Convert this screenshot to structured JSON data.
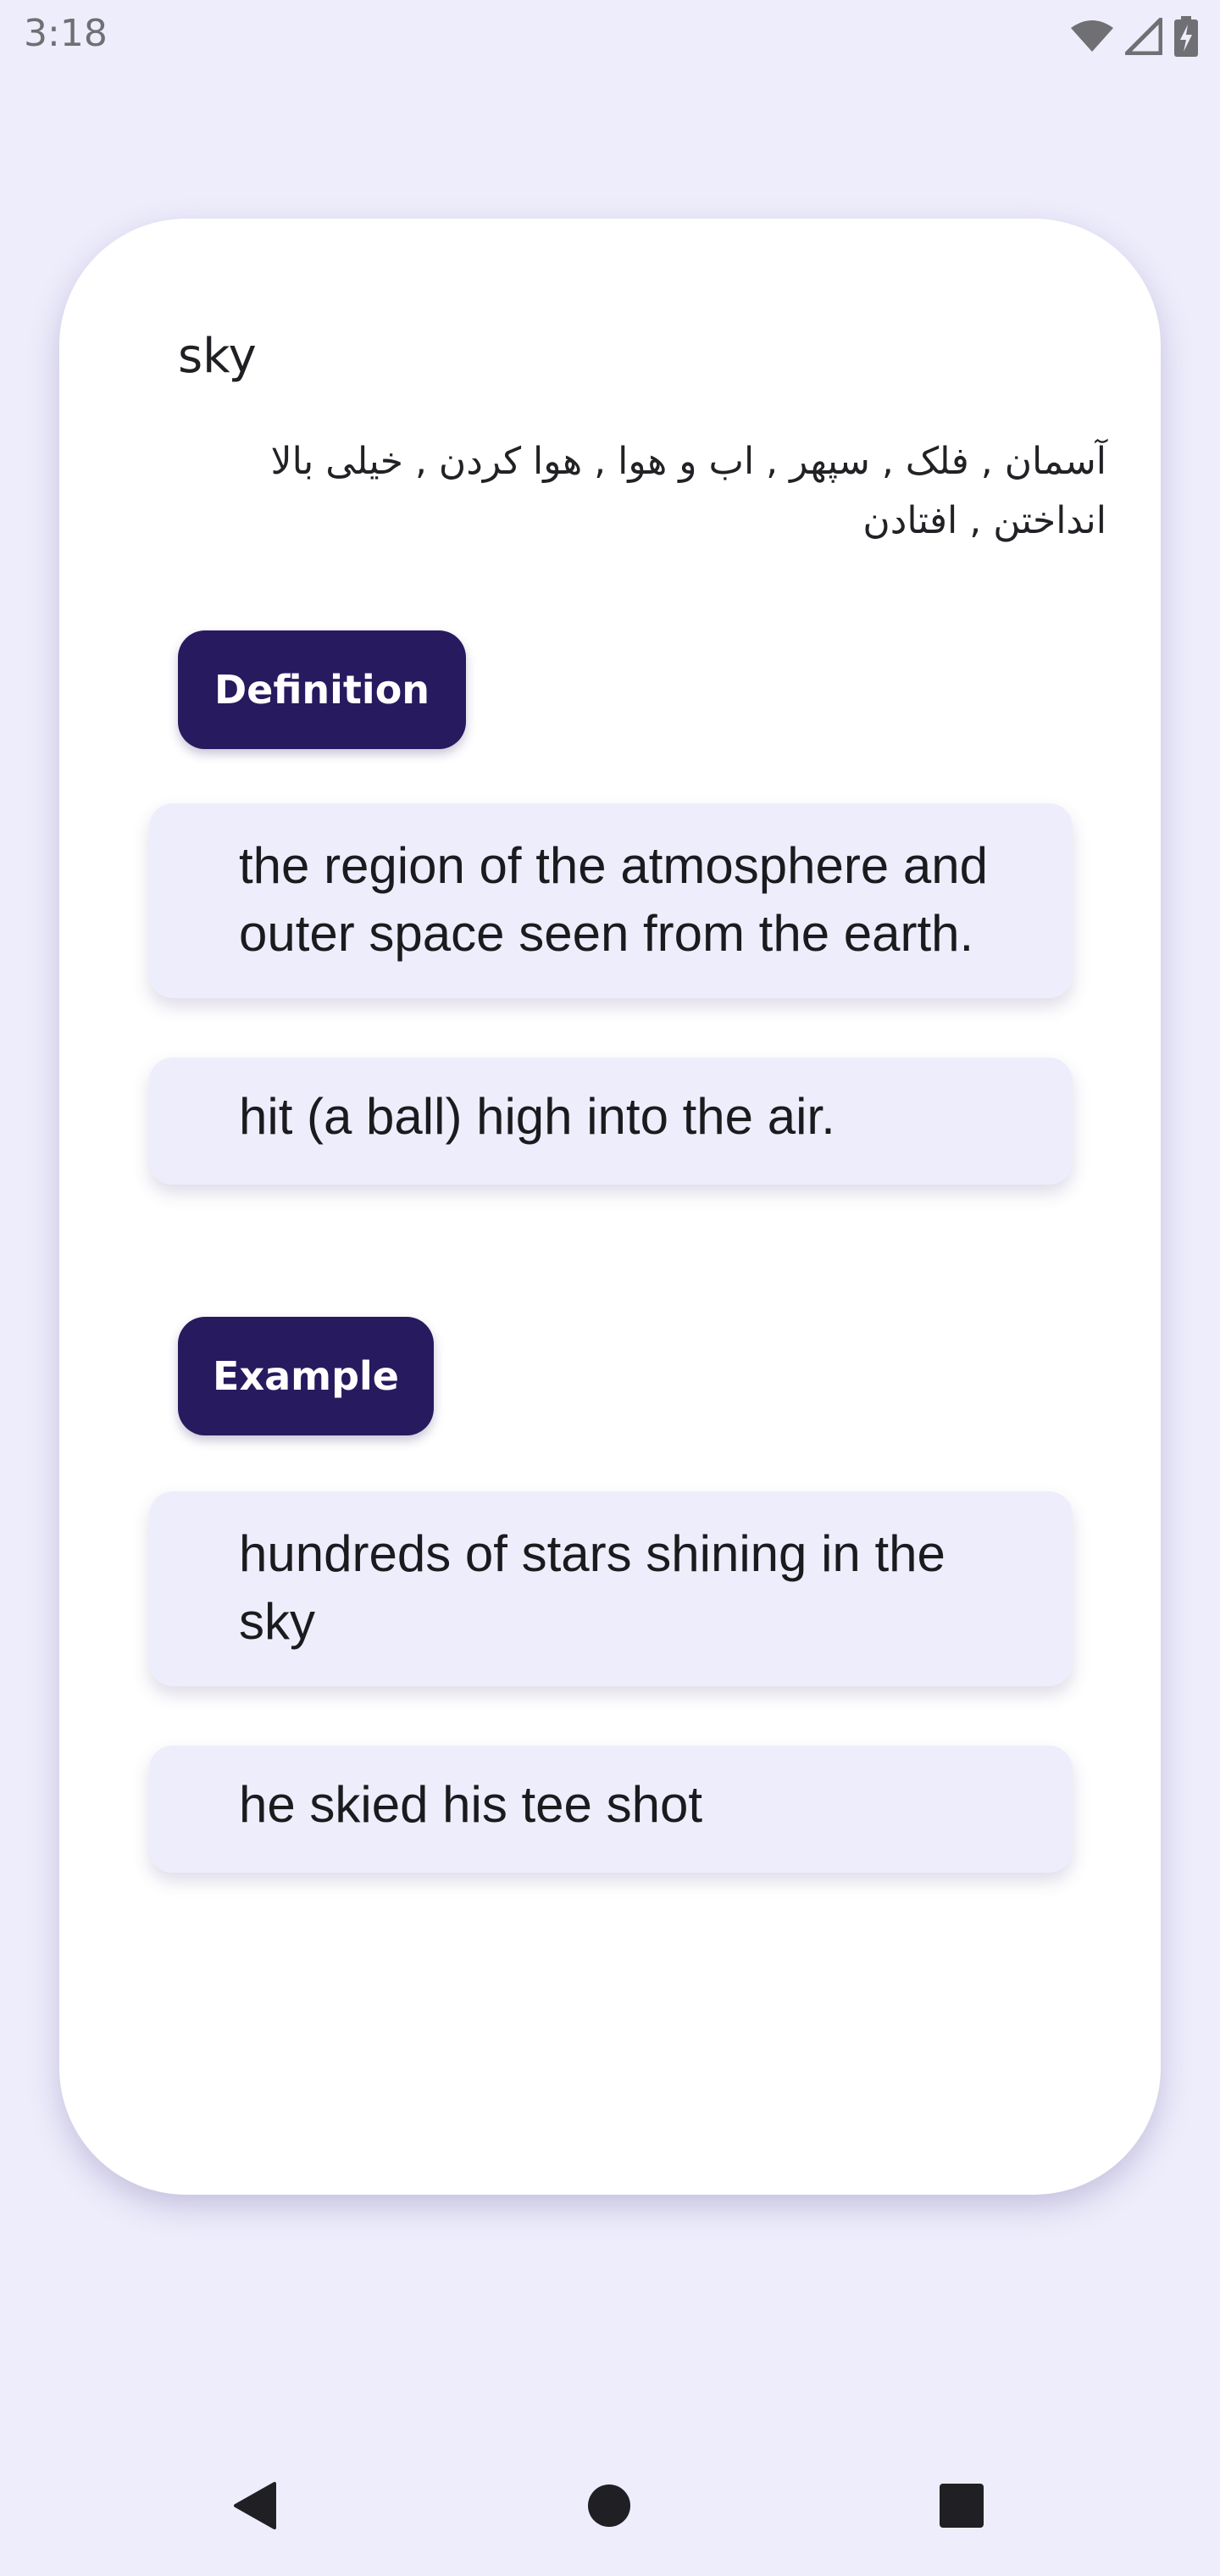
{
  "status_bar": {
    "time": "3:18",
    "icons": [
      "wifi-icon",
      "signal-icon",
      "battery-charging-icon"
    ]
  },
  "entry": {
    "word": "sky",
    "translation_line1": "آسمان , فلک , سپهر , اب و هوا , هوا کردن , خیلی بالا",
    "translation_line2": "انداختن , افتادن"
  },
  "definition": {
    "label": "Definition",
    "items": [
      {
        "line1": "the region of the atmosphere and",
        "line2": "outer space seen from the earth."
      },
      {
        "line1": "hit (a ball) high into the air."
      }
    ]
  },
  "example": {
    "label": "Example",
    "items": [
      {
        "line1": "hundreds of stars shining in the",
        "line2": "sky"
      },
      {
        "line1": "he skied his tee shot"
      }
    ]
  },
  "nav": {
    "icons": [
      "back-icon",
      "home-icon",
      "recents-icon"
    ]
  }
}
